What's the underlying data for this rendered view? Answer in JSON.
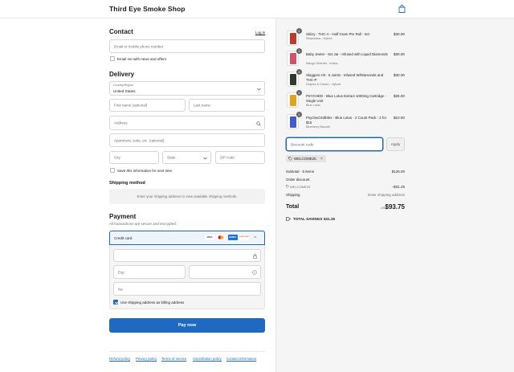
{
  "header": {
    "shop_name": "Third Eye Smoke Shop",
    "cart_icon": "shopping-bag-icon"
  },
  "contact": {
    "title": "Contact",
    "login_link": "Log in",
    "email_placeholder": "Email or mobile phone number",
    "news_label": "Email me with news and offers"
  },
  "delivery": {
    "title": "Delivery",
    "country_label": "Country/Region",
    "country_value": "United States",
    "first_name_placeholder": "First name (optional)",
    "last_name_placeholder": "Last name",
    "address_placeholder": "Address",
    "apartment_placeholder": "Apartment, suite, etc. (optional)",
    "city_placeholder": "City",
    "state_placeholder": "State",
    "zip_placeholder": "ZIP code",
    "save_label": "Save this information for next time"
  },
  "shipping": {
    "title": "Shipping method",
    "info": "Enter your shipping address to view available shipping methods."
  },
  "payment": {
    "title": "Payment",
    "subtitle": "All transactions are secure and encrypted.",
    "method_label": "Credit card",
    "card_brands": [
      "VISA",
      "MC",
      "AMEX",
      "DISCOVER",
      "+5"
    ],
    "exp_placeholder": "Exp",
    "name_placeholder": "Na",
    "billing_label": "Use shipping address as billing address",
    "pay_button": "Pay now"
  },
  "footer_links": [
    "Refund policy",
    "Privacy policy",
    "Terms of service",
    "Cancellation policy",
    "Contact information"
  ],
  "order": {
    "items": [
      {
        "name": "Stiiizy - THC-A - Half Gram Pre Roll - 5ct",
        "variant": "Strawnana - Hybrid",
        "price": "$30.00",
        "qty": "1",
        "color": "#c0392b"
      },
      {
        "name": "Baby Jeeter - 5ct Jar - Infused with Liquid Diamonds",
        "variant": "Mango Sherbet - Indica",
        "price": "$30.00",
        "qty": "1",
        "color": "#d94f6a"
      },
      {
        "name": "Sluggers Hit - 5 Joints - Infused W/Diamonds and THC-P",
        "variant": "Grapes & Cream - Hybrid",
        "price": "$30.00",
        "qty": "1",
        "color": "#2d3a2e"
      },
      {
        "name": "PSYCHED - Blue Lotus Extract 1000mg Cartridge - Single Unit",
        "variant": "Blue Lotus",
        "price": "$25.00",
        "qty": "1",
        "color": "#e3a21a"
      },
      {
        "name": "Psyched Edibles - Blue Lotus - 2 Count Pack - 2 for $15",
        "variant": "Blueberry Biscotti",
        "price": "$10.00",
        "qty": "1",
        "color": "#3d5bd6"
      }
    ],
    "discount_placeholder": "Discount code",
    "apply_button": "Apply",
    "applied_code": "WELCOME25",
    "subtotal_label": "Subtotal · 5 items",
    "subtotal_value": "$125.00",
    "order_discount_label": "Order discount",
    "discount_code": "WELCOME25",
    "discount_value": "−$31.25",
    "shipping_label": "Shipping",
    "shipping_value": "Enter shipping address",
    "total_label": "Total",
    "currency": "USD",
    "total_value": "$93.75",
    "savings_label": "TOTAL SAVINGS",
    "savings_value": "$31.25"
  },
  "colors": {
    "accent": "#1f69c0",
    "pay_button": "#1f69c0",
    "panel_bg": "#f5f5f5"
  }
}
